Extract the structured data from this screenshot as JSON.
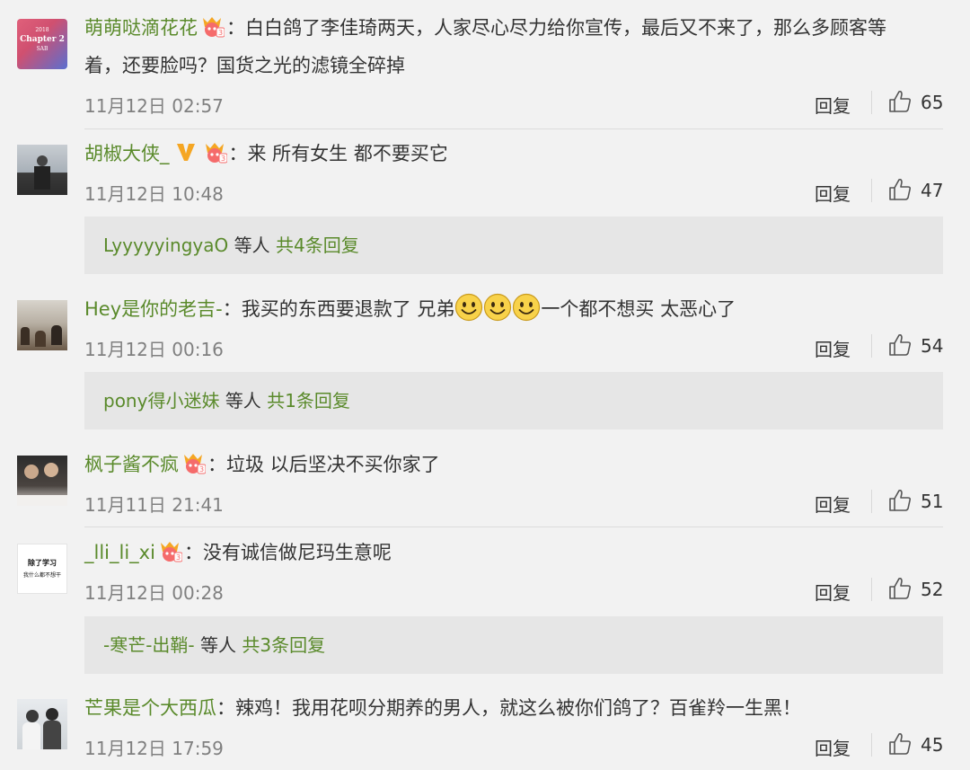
{
  "icons": {
    "badge": "vip-crown-badge-icon",
    "verified": "verified-v-icon",
    "smile": "smile-emoji-icon",
    "like": "thumbs-up-icon"
  },
  "colors": {
    "username": "#5a8a2b",
    "background": "#f2f2f2",
    "subreply_bg": "#e6e6e6"
  },
  "reply_label": "回复",
  "comments": [
    {
      "user": "萌萌哒滴花花",
      "avatar_text": [
        "2018",
        "Chapter 2",
        "SAB"
      ],
      "text_line1": "：白白鸽了李佳琦两天，人家尽心尽力给你宣传，最后又不来了，那么多顾客等",
      "text_line2": "着，还要脸吗？国货之光的滤镜全碎掉",
      "time": "11月12日 02:57",
      "likes": "65"
    },
    {
      "user": "胡椒大侠_",
      "text": "：来 所有女生 都不要买它",
      "time": "11月12日 10:48",
      "likes": "47",
      "subreply": {
        "name": "LyyyyyingyaO",
        "etc": "等人",
        "count": "共4条回复"
      }
    },
    {
      "user": "Hey是你的老吉-",
      "text_a": "：我买的东西要退款了 兄弟",
      "text_b": "一个都不想买 太恶心了",
      "time": "11月12日 00:16",
      "likes": "54",
      "subreply": {
        "name": "pony得小迷妹",
        "etc": "等人",
        "count": "共1条回复"
      }
    },
    {
      "user": "枫子酱不疯",
      "text": "：垃圾 以后坚决不买你家了",
      "time": "11月11日 21:41",
      "likes": "51"
    },
    {
      "user": "_lli_li_xi",
      "avatar_text": [
        "除了学习",
        "我什么都不想干"
      ],
      "text": "：没有诚信做尼玛生意呢",
      "time": "11月12日 00:28",
      "likes": "52",
      "subreply": {
        "name": "-寒芒-出鞘-",
        "etc": "等人",
        "count": "共3条回复"
      }
    },
    {
      "user": "芒果是个大西瓜",
      "text": "：辣鸡！我用花呗分期养的男人，就这么被你们鸽了？百雀羚一生黑！",
      "time": "11月12日 17:59",
      "likes": "45"
    }
  ]
}
